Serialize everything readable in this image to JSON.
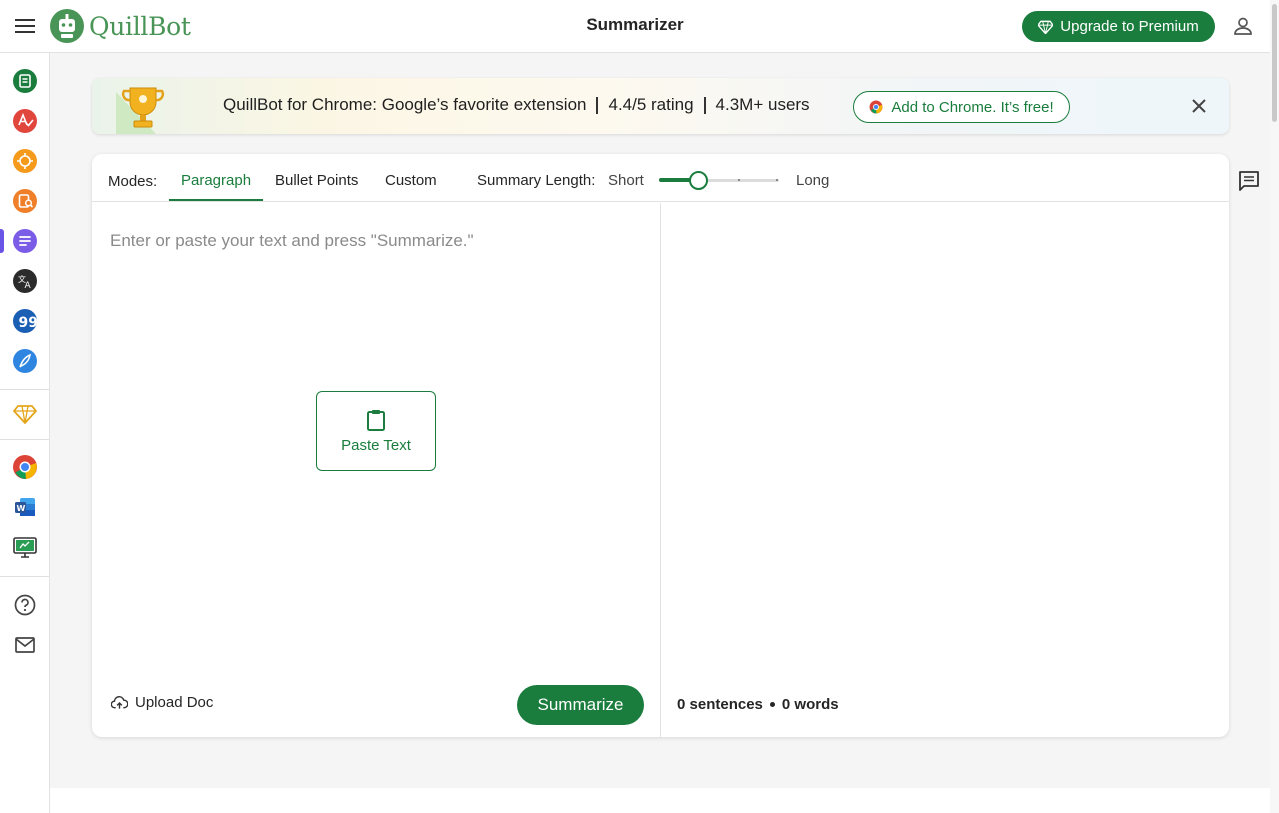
{
  "app": {
    "brand": "QuillBot",
    "page_title": "Summarizer"
  },
  "header": {
    "premium_label": "Upgrade to Premium"
  },
  "banner": {
    "text_main": "QuillBot for Chrome: Google’s favorite extension",
    "text_rating": "4.4/5 rating",
    "text_users": "4.3M+ users",
    "cta_label": "Add to Chrome. It’s free!"
  },
  "sidebar": {
    "items": [
      {
        "icon": "paraphraser-icon",
        "color": "#1a7d3d"
      },
      {
        "icon": "grammar-checker-icon",
        "color": "#e0463c"
      },
      {
        "icon": "ai-detector-icon",
        "color": "#f59a1b"
      },
      {
        "icon": "plagiarism-checker-icon",
        "color": "#f07f2a"
      },
      {
        "icon": "summarizer-icon",
        "color": "#7b5ce6"
      },
      {
        "icon": "translator-icon",
        "color": "#2b2b2b"
      },
      {
        "icon": "citation-generator-icon",
        "color": "#1a5fb4"
      },
      {
        "icon": "quillbot-flow-icon",
        "color": "#2f86e0"
      },
      {
        "icon": "premium-diamond-icon",
        "color": "#e4a51a"
      },
      {
        "icon": "chrome-extension-icon",
        "color": "#4285f4"
      },
      {
        "icon": "word-addin-icon",
        "color": "#2b579a"
      },
      {
        "icon": "desktop-app-icon",
        "color": "#1a7d3d"
      },
      {
        "icon": "help-icon",
        "color": "#444444"
      },
      {
        "icon": "mail-icon",
        "color": "#444444"
      }
    ]
  },
  "editor": {
    "modes_label": "Modes:",
    "modes": [
      "Paragraph",
      "Bullet Points",
      "Custom"
    ],
    "active_mode": "Paragraph",
    "summary_length_label": "Summary Length:",
    "length_short": "Short",
    "length_long": "Long",
    "length_level": 0.33,
    "input_placeholder": "Enter or paste your text and press \"Summarize.\"",
    "input_value": "",
    "paste_label": "Paste Text",
    "upload_label": "Upload Doc",
    "summarize_label": "Summarize",
    "sentences_count": "0 sentences",
    "words_count": "0 words"
  },
  "colors": {
    "primary": "#1a7d3d",
    "brand_text": "#499557"
  }
}
